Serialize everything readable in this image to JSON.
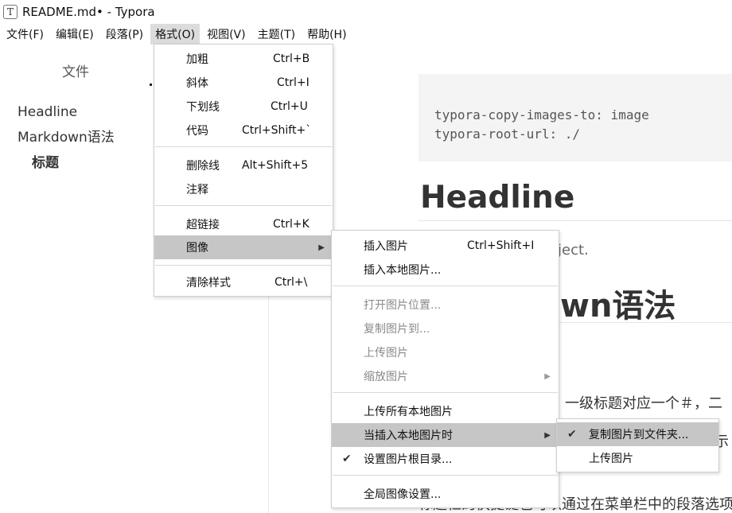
{
  "window": {
    "app_icon": "T",
    "title": "README.md• - Typora"
  },
  "menubar": [
    "文件(F)",
    "编辑(E)",
    "段落(P)",
    "格式(O)",
    "视图(V)",
    "主题(T)",
    "帮助(H)"
  ],
  "sidebar": {
    "title": "文件",
    "outline": [
      "Headline",
      "Markdown语法",
      "标题"
    ]
  },
  "editor": {
    "frontmatter": [
      "typora-copy-images-to: image",
      "typora-root-url: ./"
    ],
    "h1": "Headline",
    "para_partial": "oject.",
    "h1b_partial": "wn语法",
    "body_partial": "一级标题对应一个＃，二",
    "body_partial2": "示",
    "body_partial3": "标题栏的快捷键也可以通过在菜单栏中的段落选项下查"
  },
  "format_menu": {
    "items": [
      {
        "label": "加粗",
        "shortcut": "Ctrl+B"
      },
      {
        "label": "斜体",
        "shortcut": "Ctrl+I"
      },
      {
        "label": "下划线",
        "shortcut": "Ctrl+U"
      },
      {
        "label": "代码",
        "shortcut": "Ctrl+Shift+`"
      },
      {
        "label": "删除线",
        "shortcut": "Alt+Shift+5"
      },
      {
        "label": "注释",
        "shortcut": ""
      },
      {
        "label": "超链接",
        "shortcut": "Ctrl+K"
      },
      {
        "label": "图像",
        "shortcut": ""
      },
      {
        "label": "清除样式",
        "shortcut": "Ctrl+\\"
      }
    ]
  },
  "image_menu": {
    "items": [
      {
        "label": "插入图片",
        "shortcut": "Ctrl+Shift+I"
      },
      {
        "label": "插入本地图片...",
        "shortcut": ""
      },
      {
        "label": "打开图片位置...",
        "shortcut": ""
      },
      {
        "label": "复制图片到...",
        "shortcut": ""
      },
      {
        "label": "上传图片",
        "shortcut": ""
      },
      {
        "label": "缩放图片",
        "shortcut": ""
      },
      {
        "label": "上传所有本地图片",
        "shortcut": ""
      },
      {
        "label": "当插入本地图片时",
        "shortcut": ""
      },
      {
        "label": "设置图片根目录...",
        "shortcut": ""
      },
      {
        "label": "全局图像设置...",
        "shortcut": ""
      }
    ]
  },
  "insert_menu": {
    "items": [
      {
        "label": "复制图片到文件夹..."
      },
      {
        "label": "上传图片"
      }
    ]
  },
  "glyphs": {
    "submenu_arrow": "▶",
    "check": "✔"
  }
}
